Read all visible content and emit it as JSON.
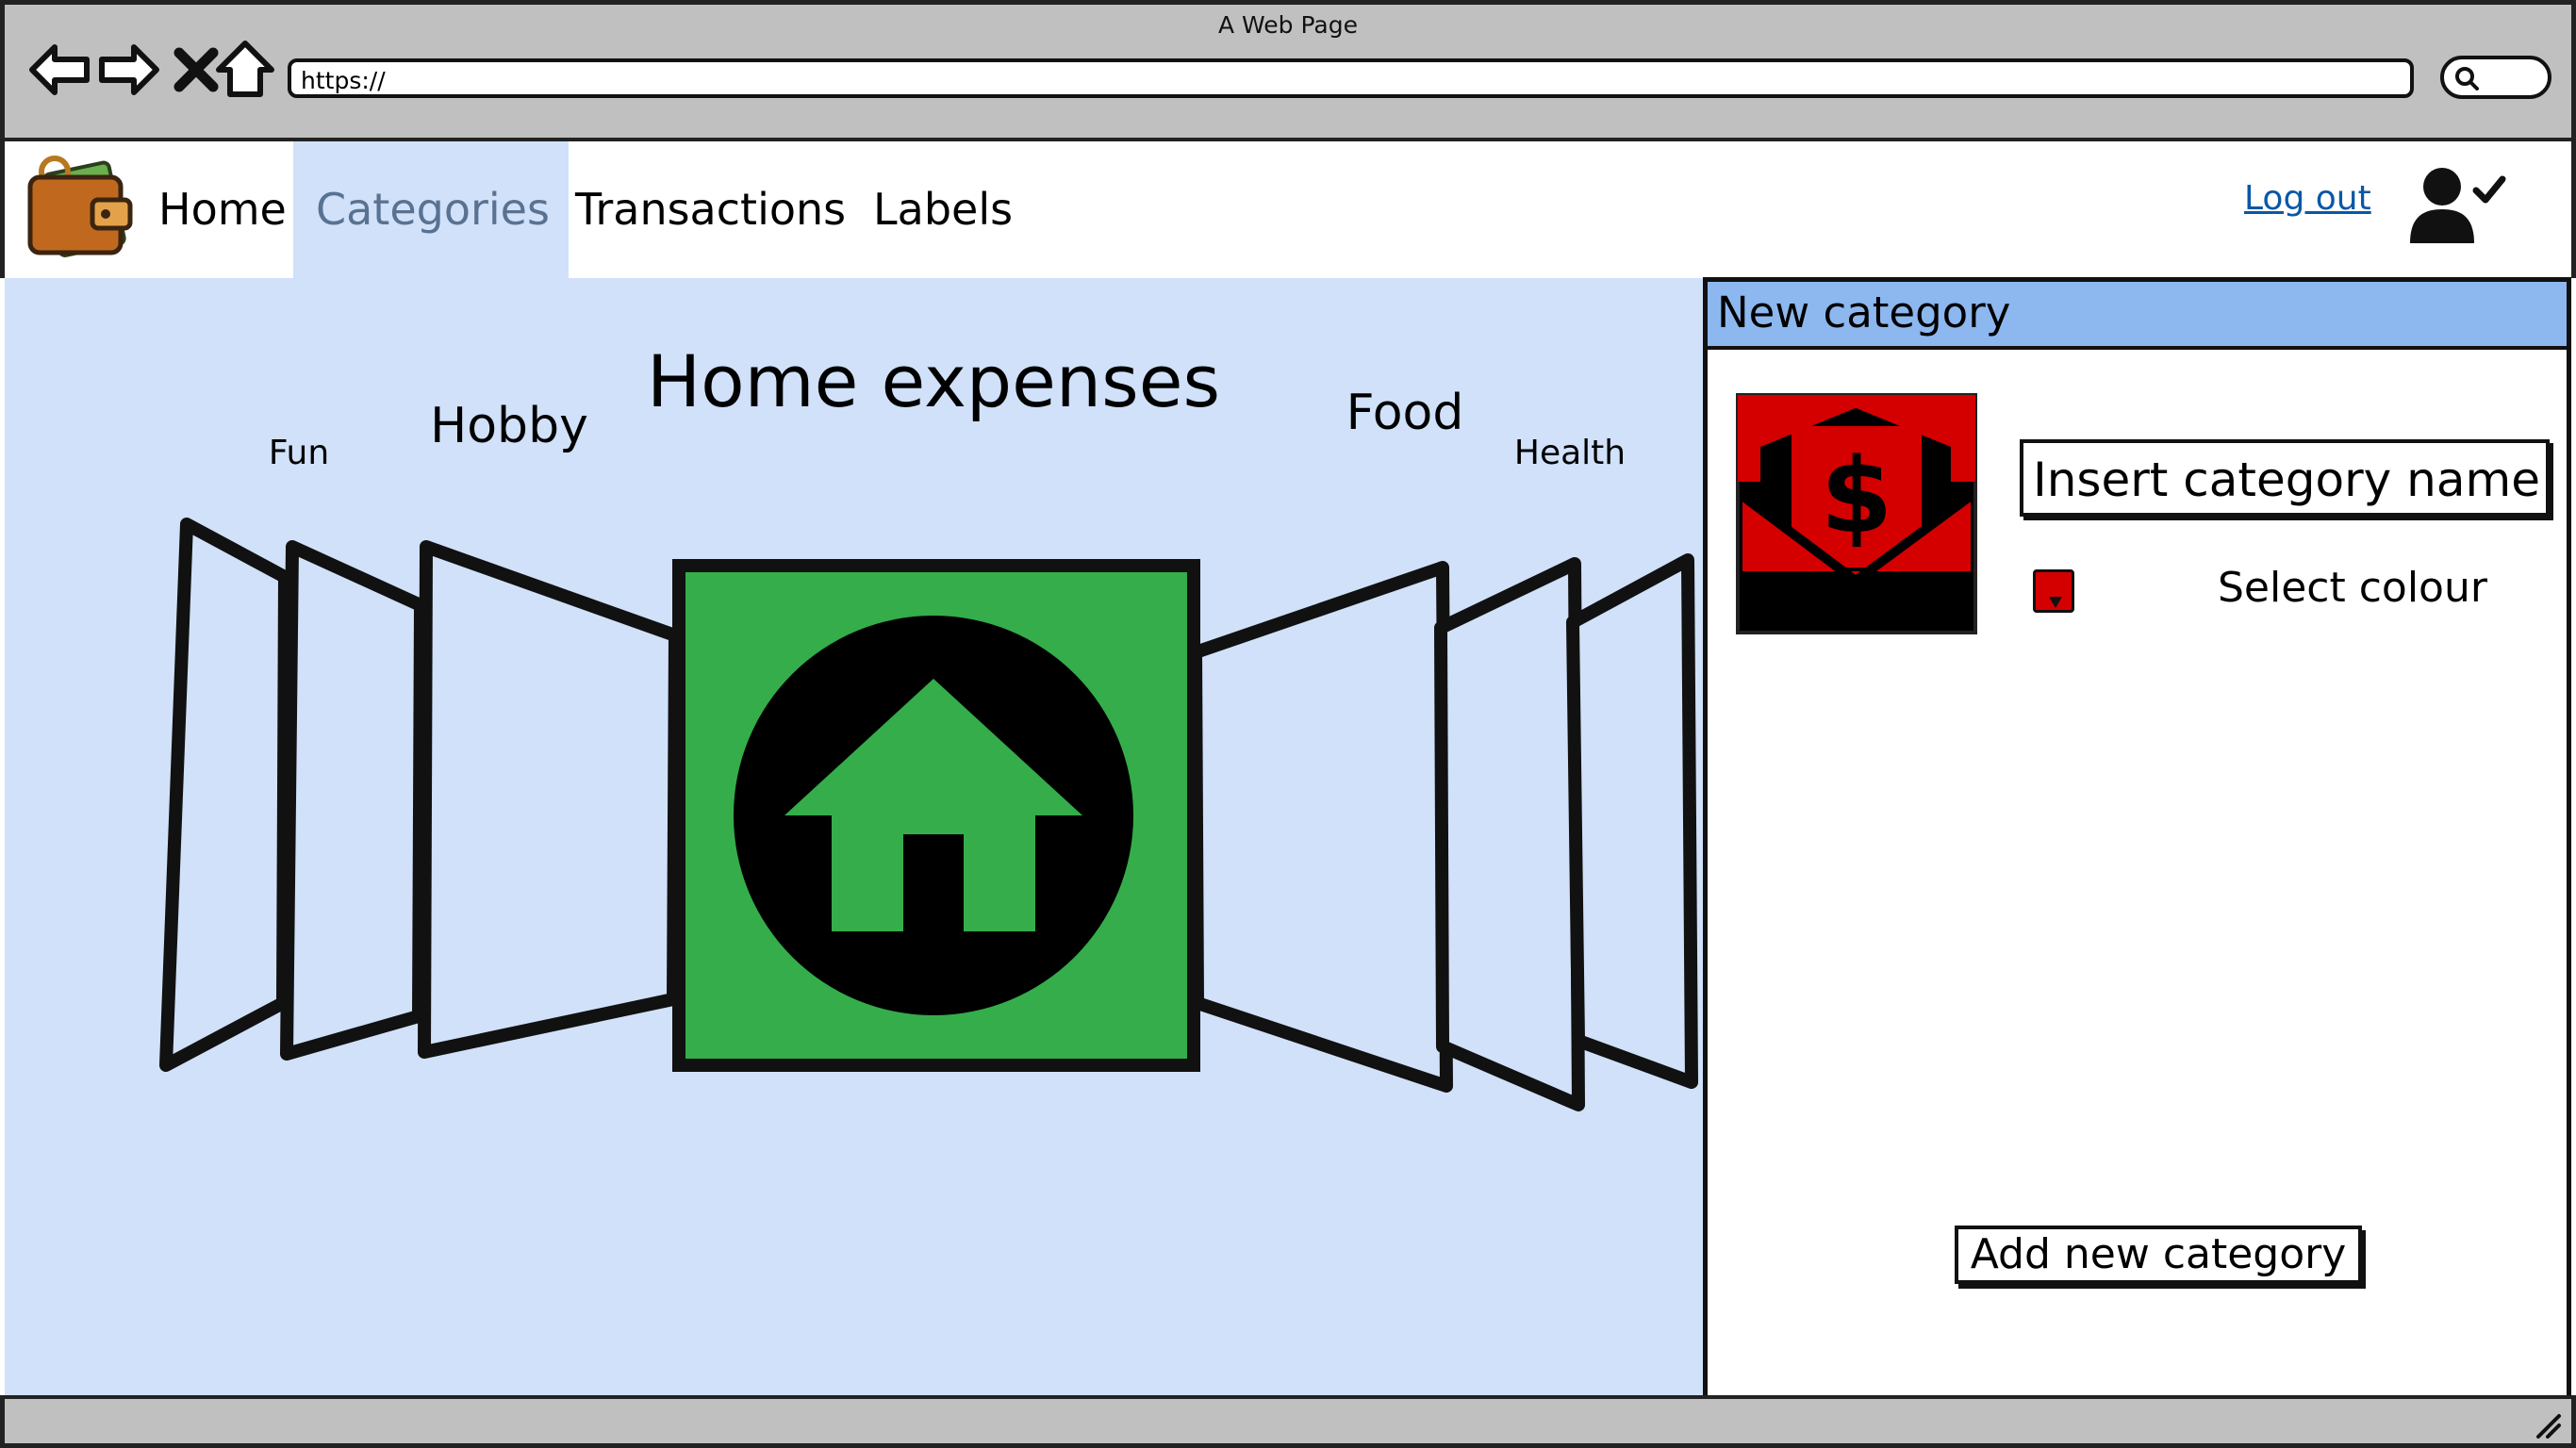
{
  "window": {
    "title": "A Web Page"
  },
  "browser": {
    "url": "https://"
  },
  "nav": {
    "items": [
      {
        "label": "Home"
      },
      {
        "label": "Categories",
        "active": true
      },
      {
        "label": "Transactions"
      },
      {
        "label": "Labels"
      }
    ],
    "logout": "Log out"
  },
  "carousel": {
    "selected": "Home expenses",
    "left": [
      "Fun",
      "Hobby"
    ],
    "right": [
      "Food",
      "Health"
    ]
  },
  "panel": {
    "title": "New category",
    "name_placeholder": "Insert category name",
    "select_colour": "Select colour",
    "add_button": "Add new category",
    "selected_colour": "#d40000"
  },
  "colors": {
    "content_bg": "#d0e1f9",
    "active_nav_bg": "#d0e1f9",
    "panel_header": "#8db7ef",
    "selected_card": "#35ad4a",
    "link": "#0a58a6"
  },
  "icons": [
    "back-arrow-icon",
    "forward-arrow-icon",
    "stop-icon",
    "home-outline-icon",
    "search-icon",
    "wallet-logo-icon",
    "user-check-icon",
    "house-icon",
    "money-envelope-icon",
    "resize-grip-icon"
  ]
}
